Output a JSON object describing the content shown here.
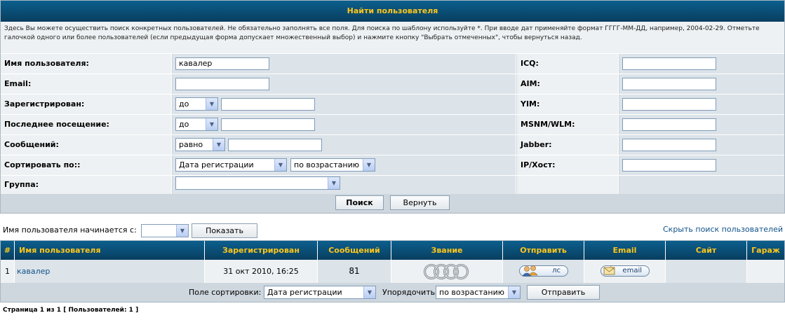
{
  "search": {
    "title": "Найти пользователя",
    "intro": "Здесь Вы можете осуществить поиск конкретных пользователей. Не обязательно заполнять все поля. Для поиска по шаблону используйте *. При вводе дат применяйте формат ГГГГ-ММ-ДД, например, 2004-02-29. Отметьте галочкой одного или более пользователей (если предыдущая форма допускает множественный выбор) и нажмите кнопку \"Выбрать отмеченных\", чтобы вернуться назад.",
    "fields": {
      "username": {
        "label": "Имя пользователя:",
        "value": "кавалер"
      },
      "email": {
        "label": "Email:",
        "value": ""
      },
      "registered": {
        "label": "Зарегистрирован:",
        "op": "до",
        "value": ""
      },
      "last_visit": {
        "label": "Последнее посещение:",
        "op": "до",
        "value": ""
      },
      "posts": {
        "label": "Сообщений:",
        "op": "равно",
        "value": ""
      },
      "sort_by": {
        "label": "Сортировать по::",
        "key": "Дата регистрации",
        "dir": "по возрастанию"
      },
      "group": {
        "label": "Группа:",
        "value": ""
      },
      "icq": {
        "label": "ICQ:",
        "value": ""
      },
      "aim": {
        "label": "AIM:",
        "value": ""
      },
      "yim": {
        "label": "YIM:",
        "value": ""
      },
      "msnm": {
        "label": "MSNM/WLM:",
        "value": ""
      },
      "jabber": {
        "label": "Jabber:",
        "value": ""
      },
      "ip": {
        "label": "IP/Хост:",
        "value": ""
      }
    },
    "search_button": "Поиск",
    "reset_button": "Вернуть"
  },
  "filter": {
    "label": "Имя пользователя начинается с:",
    "value": "",
    "show_button": "Показать",
    "hide_link": "Скрыть поиск пользователей"
  },
  "table": {
    "headers": [
      "#",
      "Имя пользователя",
      "Зарегистрирован",
      "Сообщений",
      "Звание",
      "Отправить",
      "Email",
      "Сайт",
      "Гараж"
    ],
    "rows": [
      {
        "num": "1",
        "username": "кавалер",
        "registered": "31 окт 2010, 16:25",
        "posts": "81",
        "rank_icon": "audi-rings-icon",
        "pm_label": "лс",
        "email_label": "email",
        "site": "",
        "garage": ""
      }
    ],
    "footer": {
      "sort_label": "Поле сортировки:",
      "sort_value": "Дата регистрации",
      "order_label": "Упорядочить",
      "order_value": "по возрастанию",
      "submit_button": "Отправить"
    }
  },
  "pagination": {
    "text": "Страница 1 из 1 [ Пользователей: 1 ]"
  },
  "colors": {
    "header_bg": "#0a4d74",
    "header_text": "#ffc61a",
    "link": "#105289",
    "panel_bg": "#ced6de"
  }
}
